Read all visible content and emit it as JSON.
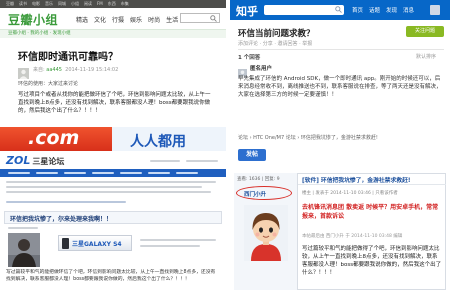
{
  "colors": {
    "douban_green": "#3b9b3b",
    "zhihu_blue": "#0767c8",
    "zol_red": "#e53b1f",
    "zol_blue": "#1f5fbf",
    "htc_blue": "#2d6fcf",
    "highlight_ring": "#d9302a",
    "alert_red": "#d22222"
  },
  "icons": {
    "search": "search-icon"
  },
  "douban": {
    "topbar": [
      "豆瓣",
      "读书",
      "电影",
      "音乐",
      "同城",
      "小组",
      "阅读",
      "FM",
      "东西",
      "市集"
    ],
    "logo": "豆瓣小组",
    "nav": [
      "精选",
      "文化",
      "行摄",
      "娱乐",
      "时尚",
      "生活"
    ],
    "subnav": "豆瓣小组 · 我的小组 · 发现小组",
    "title": "环信即时通讯可靠吗？",
    "meta_label": "来自: ",
    "author": "aa445",
    "time": "2014-11-19 15:14:02",
    "note": "环信的使用：大家过来讨论",
    "body": "写过项目个或者从找你的能把做环信了个吧，环信到影响问题太比较，从上午一直找到晚上8点多，还没有找到解决，联系客服都没人理！boss都要跟我说你做的，然后我这个出了什么？！！！"
  },
  "zhihu": {
    "logo": "知乎",
    "nav": [
      "首页",
      "话题",
      "发现",
      "消息"
    ],
    "title": "环信当前问题求教？",
    "follow_label": "关注问题",
    "actions": "添加评论 · 分享 · 邀请回答 · 举报",
    "answer_count": "1 个回答",
    "sort_label": "默认排序",
    "answer_author": "匿名用户",
    "answer_body": "早先集成了环信的 Android SDK，做一个即时通讯 app。刚开始的时候还可以，后来消息经常收不到，离线推送也不到，联系客服说在排查，等了两天还是没有解决，大家在选择第三方的时候一定要谨慎！！"
  },
  "zol": {
    "banner_left": ".com",
    "banner_right": "人人都用",
    "logo_brand": "ZOL",
    "logo_name": "三星论坛",
    "post_title": "环信把我坑惨了，尔来处理来我啊！！",
    "ad_label": "三星GALAXY S4",
    "body": "写过篇较平和气的能把做环信了个吧，环信到影响问题太比较，从上午一直找到晚上8点多，还没有找到解决，联系客服都没人理！boss都要跟我说你做的，然后我这个出了什么？！！！"
  },
  "htc": {
    "breadcrumb": "论坛 › HTC One/M7 论坛 › 环信把我坑惨了，金游社禁求救赶!",
    "post_button": "发帖",
    "stats": "查看: 1636 | 回复: 9",
    "title": "[软件] 环信把我坑惨了，金游社禁求救赶!",
    "username": "西门小升",
    "meta": "楼主 | 发表于 2014-11-10 03:46 | 只看该作者",
    "red_text": "去机锋讯消息团 散卖返 时候平？用安卓手机，常常报来，首款诉讼",
    "edit_note": "本帖最后由 西门小升 于 2014-11-10 03:48 编辑",
    "body": "写过篇较平和气的能把做得了个吧，环信到影响问题太比较，从上午一直找到晚上8点多，还没有找到解决，联系客服都没人理！boss都要跟我说你做的，然后我这个出了什么？！！！"
  }
}
